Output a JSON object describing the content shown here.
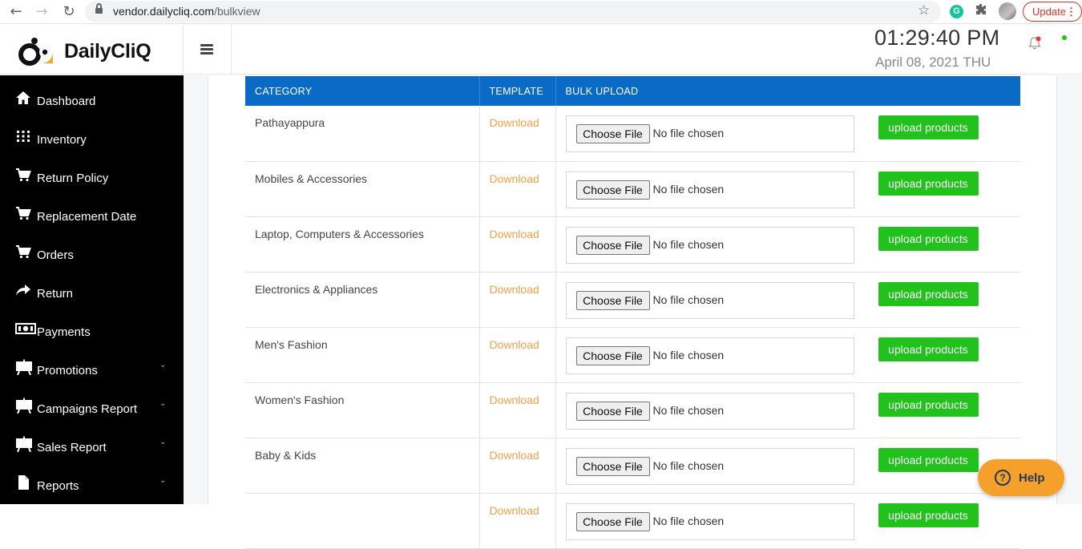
{
  "browser": {
    "url_host": "vendor.dailycliq.com",
    "url_path": "/bulkview",
    "update_label": "Update",
    "extension_letter": "G"
  },
  "header": {
    "logo_text": "DailyCliQ",
    "time": "01:29:40 PM",
    "date": "April 08, 2021 THU"
  },
  "sidebar": {
    "items": [
      {
        "label": "Dashboard",
        "icon": "home-icon",
        "has_chevron": false
      },
      {
        "label": "Inventory",
        "icon": "grid-icon",
        "has_chevron": false
      },
      {
        "label": "Return Policy",
        "icon": "cart-icon",
        "has_chevron": false
      },
      {
        "label": "Replacement Date",
        "icon": "cart-icon",
        "has_chevron": false
      },
      {
        "label": "Orders",
        "icon": "cart-icon",
        "has_chevron": false
      },
      {
        "label": "Return",
        "icon": "share-arrow-icon",
        "has_chevron": false
      },
      {
        "label": "Payments",
        "icon": "money-icon",
        "has_chevron": false
      },
      {
        "label": "Promotions",
        "icon": "easel-icon",
        "has_chevron": true
      },
      {
        "label": "Campaigns Report",
        "icon": "easel-icon",
        "has_chevron": true
      },
      {
        "label": "Sales Report",
        "icon": "easel-icon",
        "has_chevron": true
      },
      {
        "label": "Reports",
        "icon": "file-icon",
        "has_chevron": true
      }
    ]
  },
  "table": {
    "headers": [
      "CATEGORY",
      "TEMPLATE",
      "BULK UPLOAD"
    ],
    "download_label": "Download",
    "choose_file_label": "Choose File",
    "no_file_label": "No file chosen",
    "upload_label": "upload products",
    "rows": [
      {
        "category": "Pathayappura"
      },
      {
        "category": "Mobiles & Accessories"
      },
      {
        "category": "Laptop, Computers & Accessories"
      },
      {
        "category": "Electronics & Appliances"
      },
      {
        "category": "Men's Fashion"
      },
      {
        "category": "Women's Fashion"
      },
      {
        "category": "Baby & Kids"
      },
      {
        "category": ""
      }
    ]
  },
  "help": {
    "label": "Help"
  },
  "colors": {
    "table_header": "#0a6bc7",
    "upload_button": "#21c21c",
    "download_link": "#f0a04b",
    "help_button": "#f5a02b",
    "sidebar_bg": "#000000"
  }
}
